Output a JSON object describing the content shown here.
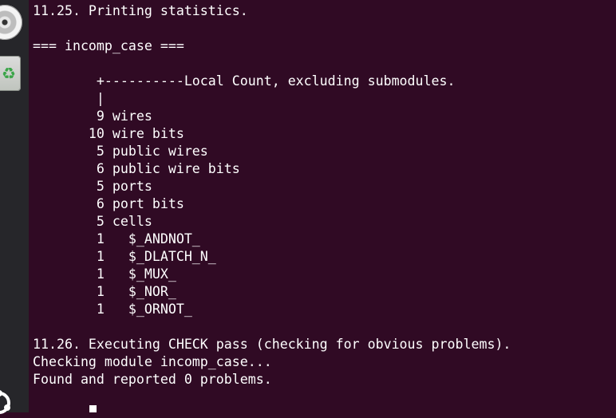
{
  "dock": {
    "icons": [
      "disc-icon",
      "trash-icon",
      "ubuntu-icon"
    ],
    "recycle_glyph": "♻"
  },
  "terminal": {
    "lines": [
      "11.25. Printing statistics.",
      "",
      "=== incomp_case ===",
      "",
      "        +----------Local Count, excluding submodules.",
      "        |",
      "        9 wires",
      "       10 wire bits",
      "        5 public wires",
      "        6 public wire bits",
      "        5 ports",
      "        6 port bits",
      "        5 cells",
      "        1   $_ANDNOT_",
      "        1   $_DLATCH_N_",
      "        1   $_MUX_",
      "        1   $_NOR_",
      "        1   $_ORNOT_",
      "",
      "11.26. Executing CHECK pass (checking for obvious problems).",
      "Checking module incomp_case...",
      "Found and reported 0 problems."
    ]
  },
  "colors": {
    "background": "#300a24",
    "text": "#ffffff",
    "dock": "#26262a"
  }
}
